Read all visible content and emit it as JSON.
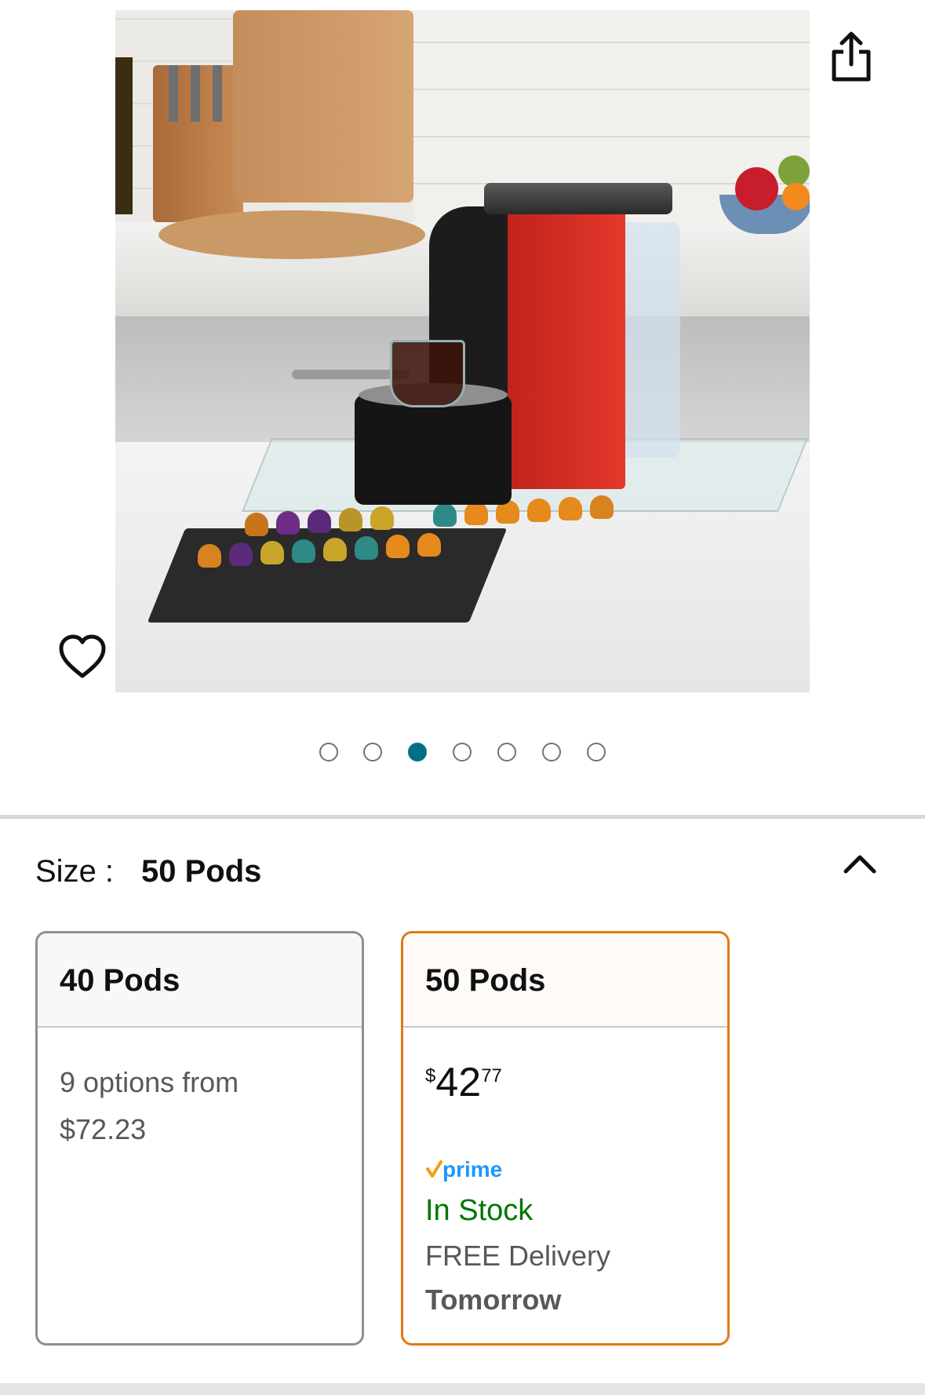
{
  "product": {
    "image_alt": "Coffee pod storage drawer with glass top under espresso machine",
    "carousel": {
      "count": 7,
      "active_index": 2
    }
  },
  "colors": {
    "accent_teal": "#007185",
    "selected_border": "#e47911",
    "in_stock_green": "#007600",
    "prime_blue": "#1a98ff"
  },
  "icons": {
    "share": "share-icon",
    "wishlist": "heart-icon",
    "collapse": "chevron-up-icon",
    "prime": "prime-logo"
  },
  "size": {
    "label": "Size :",
    "selected_value": "50 Pods",
    "options": [
      {
        "name": "40 Pods",
        "options_line": "9 options from",
        "from_price": "$72.23"
      },
      {
        "name": "50 Pods",
        "price_currency": "$",
        "price_whole": "42",
        "price_fraction": "77",
        "prime": "prime",
        "stock": "In Stock",
        "delivery": "FREE Delivery",
        "delivery_day": "Tomorrow"
      }
    ]
  }
}
